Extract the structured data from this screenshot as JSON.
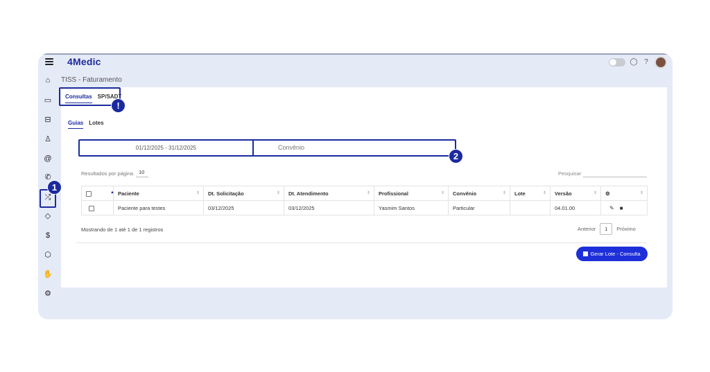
{
  "app": {
    "logo": "4Medic",
    "page_title": "TISS - Faturamento"
  },
  "sidebar": {
    "items": [
      {
        "name": "home-icon",
        "glyph": "⌂"
      },
      {
        "name": "calendar-icon",
        "glyph": "▭"
      },
      {
        "name": "car-icon",
        "glyph": "⊟"
      },
      {
        "name": "user-icon",
        "glyph": "♙"
      },
      {
        "name": "at-icon",
        "glyph": "@"
      },
      {
        "name": "phone-icon",
        "glyph": "✆"
      },
      {
        "name": "shuffle-icon",
        "glyph": "⤮"
      },
      {
        "name": "tag-icon",
        "glyph": "◇"
      },
      {
        "name": "dollar-icon",
        "glyph": "$"
      },
      {
        "name": "box-icon",
        "glyph": "⬡"
      },
      {
        "name": "hand-icon",
        "glyph": "✋"
      },
      {
        "name": "gear-icon",
        "glyph": "⚙"
      }
    ]
  },
  "top_tabs": [
    {
      "label": "Consultas",
      "active": true
    },
    {
      "label": "SP/SADT",
      "active": false
    }
  ],
  "sub_tabs": [
    {
      "label": "Guias",
      "active": true
    },
    {
      "label": "Lotes",
      "active": false
    }
  ],
  "badges": {
    "first": "1",
    "exclaim": "!",
    "second": "2"
  },
  "filters": {
    "date_range": "01/12/2025 - 31/12/2025",
    "convenio_placeholder": "Convênio"
  },
  "list_controls": {
    "per_page_label": "Resultados por página",
    "per_page_value": "10",
    "search_label": "Pesquisar"
  },
  "table": {
    "columns": [
      "",
      "Paciente",
      "Dt. Solicitação",
      "Dt. Atendimento",
      "Profissional",
      "Convênio",
      "Lote",
      "Versão",
      ""
    ],
    "rows": [
      [
        "",
        "Paciente para testes",
        "03/12/2025",
        "03/12/2025",
        "Yasmim Santos",
        "Particular",
        "",
        "04.01.00",
        ""
      ]
    ]
  },
  "footer": {
    "info": "Mostrando de 1 até 1 de 1 registros",
    "prev": "Anterior",
    "page": "1",
    "next": "Próximo",
    "gerar_button": "Gerar Lote - Consulta"
  },
  "colors": {
    "accent": "#1b2a9e",
    "button": "#1d2fd8",
    "frame": "#e5eaf7"
  }
}
